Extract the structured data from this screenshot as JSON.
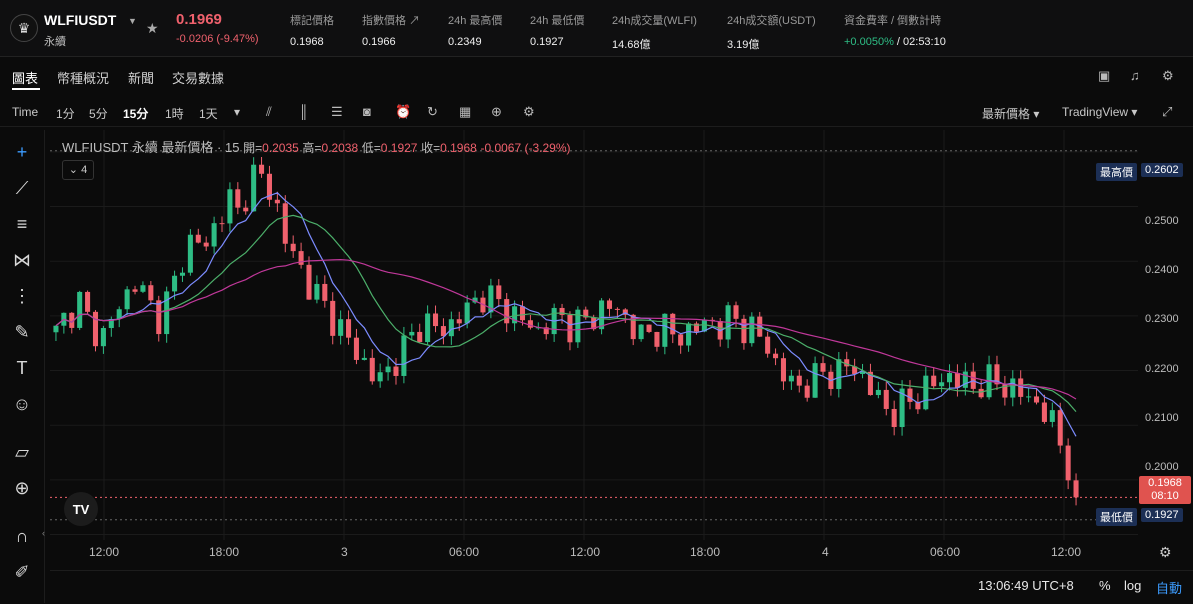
{
  "header": {
    "symbol": "WLFIUSDT",
    "market_type": "永續",
    "last_price": "0.1969",
    "change": "-0.0206 (-9.47%)",
    "stats": [
      {
        "label": "標記價格",
        "value": "0.1968"
      },
      {
        "label": "指數價格 ↗",
        "value": "0.1966"
      },
      {
        "label": "24h 最高價",
        "value": "0.2349"
      },
      {
        "label": "24h 最低價",
        "value": "0.1927"
      },
      {
        "label": "24h成交量(WLFI)",
        "value": "14.68億"
      },
      {
        "label": "24h成交額(USDT)",
        "value": "3.19億"
      },
      {
        "label": "資金費率 / 倒數計時",
        "value_green": "+0.0050%",
        "value_rest": " / 02:53:10"
      }
    ]
  },
  "tabs": [
    "圖表",
    "幣種概況",
    "新聞",
    "交易數據"
  ],
  "toolbar": {
    "time_label": "Time",
    "intervals": [
      "1分",
      "5分",
      "15分",
      "1時",
      "1天"
    ],
    "selected_interval": "15分",
    "price_type": "最新價格",
    "view": "TradingView"
  },
  "legend": {
    "title": "WLFIUSDT 永續 最新價格 · 15",
    "open_label": "開=",
    "open": "0.2035",
    "high_label": "高=",
    "high": "0.2038",
    "low_label": "低=",
    "low": "0.1927",
    "close_label": "收=",
    "close": "0.1968",
    "delta": "-0.0067 (-3.29%)",
    "indicators_count": "4"
  },
  "price_axis": {
    "ticks": [
      "0.2500",
      "0.2400",
      "0.2300",
      "0.2200",
      "0.2100",
      "0.2000"
    ],
    "high_label": "最高價",
    "high_value": "0.2602",
    "low_label": "最低價",
    "low_value": "0.1927",
    "current_value": "0.1968",
    "countdown": "08:10"
  },
  "time_axis": [
    "12:00",
    "18:00",
    "3",
    "06:00",
    "12:00",
    "18:00",
    "4",
    "06:00",
    "12:00"
  ],
  "bottom": {
    "clock": "13:06:49 UTC+8",
    "percent": "%",
    "log": "log",
    "auto": "自動"
  },
  "colors": {
    "up": "#2ebd85",
    "down": "#f0616d",
    "ma_fast": "#7c8cff",
    "ma_mid": "#4caf6a",
    "ma_slow": "#c0389a"
  },
  "chart_data": {
    "type": "candlestick",
    "ylim": [
      0.189,
      0.264
    ],
    "high": 0.2602,
    "low": 0.1927,
    "close_series": [
      0.227,
      0.23,
      0.233,
      0.228,
      0.226,
      0.23,
      0.233,
      0.237,
      0.232,
      0.23,
      0.234,
      0.24,
      0.245,
      0.242,
      0.247,
      0.252,
      0.248,
      0.256,
      0.255,
      0.252,
      0.244,
      0.24,
      0.236,
      0.233,
      0.23,
      0.227,
      0.224,
      0.221,
      0.218,
      0.22,
      0.223,
      0.226,
      0.229,
      0.228,
      0.227,
      0.23,
      0.231,
      0.234,
      0.233,
      0.232,
      0.23,
      0.229,
      0.227,
      0.229,
      0.23,
      0.228,
      0.229,
      0.23,
      0.232,
      0.231,
      0.229,
      0.226,
      0.227,
      0.228,
      0.226,
      0.227,
      0.228,
      0.229,
      0.228,
      0.23,
      0.228,
      0.227,
      0.225,
      0.22,
      0.218,
      0.217,
      0.218,
      0.22,
      0.219,
      0.221,
      0.22,
      0.217,
      0.214,
      0.212,
      0.214,
      0.215,
      0.217,
      0.218,
      0.219,
      0.218,
      0.217,
      0.218,
      0.218,
      0.217,
      0.216,
      0.215,
      0.213,
      0.21,
      0.205,
      0.1968
    ]
  }
}
